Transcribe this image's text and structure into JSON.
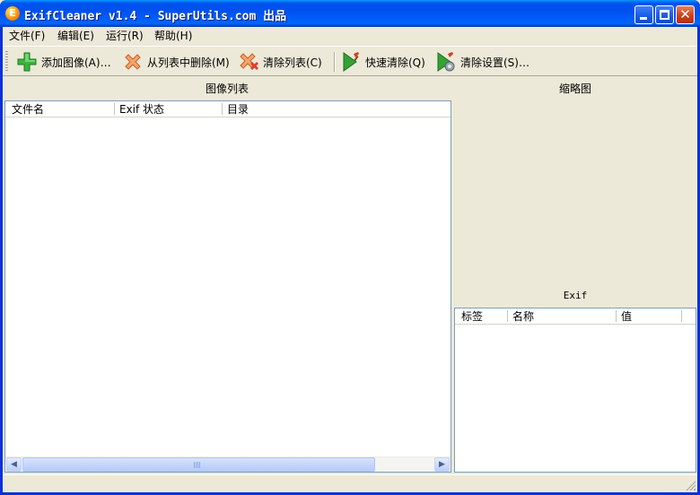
{
  "window": {
    "title": "ExifCleaner v1.4 - SuperUtils.com 出品",
    "app_icon_letter": "E"
  },
  "menu": [
    {
      "label": "文件(F)"
    },
    {
      "label": "编辑(E)"
    },
    {
      "label": "运行(R)"
    },
    {
      "label": "帮助(H)"
    }
  ],
  "toolbar": {
    "add_images": "添加图像(A)…",
    "remove_from_list": "从列表中删除(M)",
    "clear_list": "清除列表(C)",
    "quick_clean": "快速清除(Q)",
    "clean_settings": "清除设置(S)…"
  },
  "image_list": {
    "title": "图像列表",
    "columns": [
      "文件名",
      "Exif 状态",
      "目录"
    ],
    "rows": []
  },
  "thumbnail": {
    "title": "缩略图"
  },
  "exif": {
    "title": "Exif",
    "columns": [
      "标签",
      "名称",
      "值"
    ],
    "rows": []
  },
  "colors": {
    "titlebar_blue": "#0055ea",
    "window_face": "#ece9d8",
    "list_border": "#7f9db9"
  }
}
